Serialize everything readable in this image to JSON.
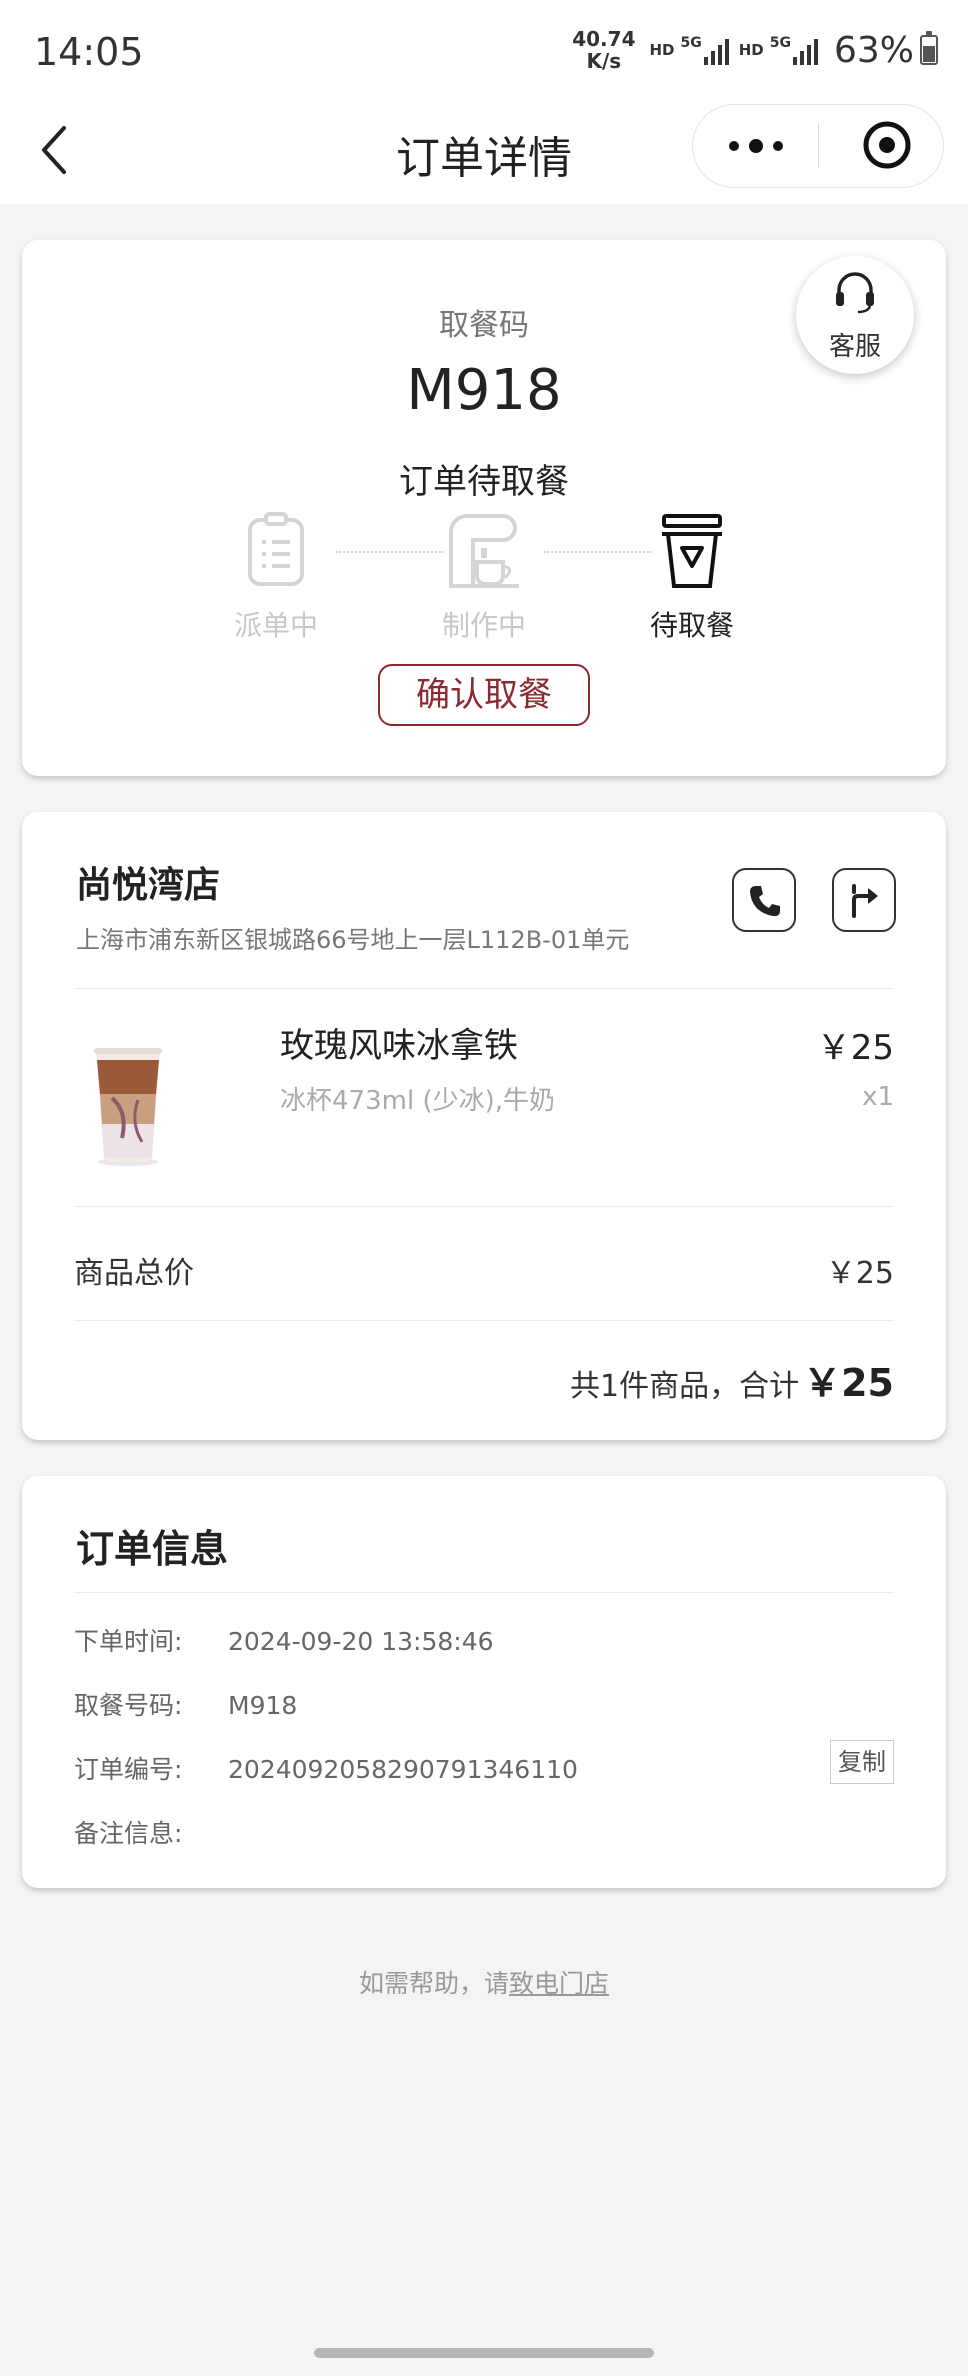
{
  "status_bar": {
    "time": "14:05",
    "net_speed_value": "40.74",
    "net_speed_unit": "K/s",
    "hd_1": "HD",
    "net_1": "5G",
    "hd_2": "HD",
    "net_2": "5G",
    "battery": "63%"
  },
  "nav": {
    "title": "订单详情"
  },
  "order_card": {
    "customer_service_label": "客服",
    "pickup_code_label": "取餐码",
    "pickup_code": "M918",
    "order_status": "订单待取餐",
    "steps": [
      {
        "label": "派单中"
      },
      {
        "label": "制作中"
      },
      {
        "label": "待取餐"
      }
    ],
    "confirm_label": "确认取餐"
  },
  "store": {
    "name": "尚悦湾店",
    "address": "上海市浦东新区银城路66号地上一层L112B-01单元"
  },
  "product": {
    "name": "玫瑰风味冰拿铁",
    "spec": "冰杯473ml (少冰),牛奶",
    "price": "￥25",
    "qty": "x1"
  },
  "summary": {
    "subtotal_label": "商品总价",
    "subtotal_value": "￥25",
    "total_label": "共1件商品，合计",
    "total_value": "￥25"
  },
  "order_info": {
    "title": "订单信息",
    "rows": [
      {
        "key": "下单时间:",
        "value": "2024-09-20 13:58:46"
      },
      {
        "key": "取餐号码:",
        "value": "M918"
      },
      {
        "key": "订单编号:",
        "value": "2024092058290791346110"
      },
      {
        "key": "备注信息:",
        "value": ""
      }
    ],
    "copy_label": "复制"
  },
  "help": {
    "prefix": "如需帮助，请",
    "link": "致电门店"
  }
}
